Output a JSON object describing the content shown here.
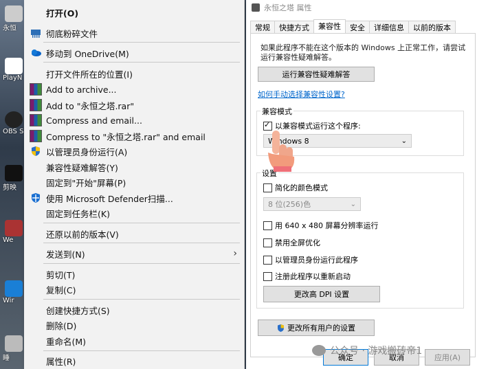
{
  "desktop": {
    "icons": [
      {
        "label": "永恒"
      },
      {
        "label": "PlayN"
      },
      {
        "label": "OBS S"
      },
      {
        "label": "剪映"
      },
      {
        "label": "We"
      },
      {
        "label": "Wir"
      },
      {
        "label": "睡"
      }
    ]
  },
  "context_menu": {
    "items": [
      {
        "label": "打开(O)",
        "icon": "none"
      },
      {
        "label": "彻底粉碎文件",
        "icon": "shredder-icon"
      },
      {
        "label": "移动到 OneDrive(M)",
        "icon": "onedrive-icon"
      },
      {
        "label": "打开文件所在的位置(I)",
        "icon": "none"
      },
      {
        "label": "Add to archive...",
        "icon": "winrar-icon"
      },
      {
        "label": "Add to \"永恒之塔.rar\"",
        "icon": "winrar-icon"
      },
      {
        "label": "Compress and email...",
        "icon": "winrar-icon"
      },
      {
        "label": "Compress to \"永恒之塔.rar\" and email",
        "icon": "winrar-icon"
      },
      {
        "label": "以管理员身份运行(A)",
        "icon": "shield-icon"
      },
      {
        "label": "兼容性疑难解答(Y)",
        "icon": "none"
      },
      {
        "label": "固定到\"开始\"屏幕(P)",
        "icon": "none"
      },
      {
        "label": "使用 Microsoft Defender扫描...",
        "icon": "defender-icon"
      },
      {
        "label": "固定到任务栏(K)",
        "icon": "none"
      },
      {
        "label": "还原以前的版本(V)",
        "icon": "none"
      },
      {
        "label": "发送到(N)",
        "icon": "none"
      },
      {
        "label": "剪切(T)",
        "icon": "none"
      },
      {
        "label": "复制(C)",
        "icon": "none"
      },
      {
        "label": "创建快捷方式(S)",
        "icon": "none"
      },
      {
        "label": "删除(D)",
        "icon": "none"
      },
      {
        "label": "重命名(M)",
        "icon": "none"
      },
      {
        "label": "属性(R)",
        "icon": "none"
      }
    ]
  },
  "properties": {
    "title": "永恒之塔 属性",
    "tabs": [
      "常规",
      "快捷方式",
      "兼容性",
      "安全",
      "详细信息",
      "以前的版本"
    ],
    "active_tab": "兼容性",
    "description": "如果此程序不能在这个版本的 Windows 上正常工作，请尝试运行兼容性疑难解答。",
    "troubleshoot_button": "运行兼容性疑难解答",
    "manual_link": "如何手动选择兼容性设置?",
    "compat_mode": {
      "group_label": "兼容模式",
      "checkbox_label": "以兼容模式运行这个程序:",
      "checked": true,
      "select_value": "Windows 8"
    },
    "settings": {
      "group_label": "设置",
      "reduced_color": {
        "label": "简化的颜色模式",
        "checked": false
      },
      "color_select": "8 位(256)色",
      "res_640": {
        "label": "用 640 x 480 屏幕分辨率运行",
        "checked": false
      },
      "disable_fullscreen": {
        "label": "禁用全屏优化",
        "checked": false
      },
      "run_admin": {
        "label": "以管理员身份运行此程序",
        "checked": false
      },
      "register_restart": {
        "label": "注册此程序以重新启动",
        "checked": false
      },
      "dpi_button": "更改高 DPI 设置"
    },
    "all_users_button": "更改所有用户的设置",
    "ok": "确定",
    "cancel": "取消",
    "apply": "应用(A)"
  },
  "watermark": "公众号 · 游戏搬砖帝1"
}
